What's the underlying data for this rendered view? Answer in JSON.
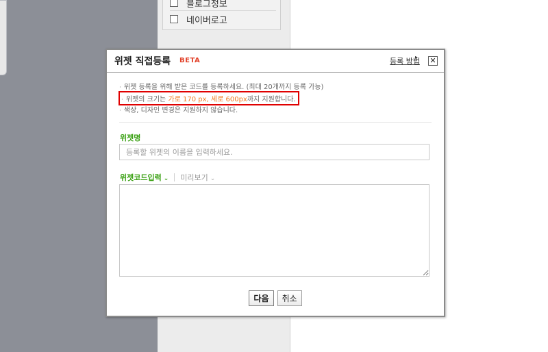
{
  "background": {
    "list_items": [
      {
        "label": "블로그정보"
      },
      {
        "label": "네이버로고"
      }
    ]
  },
  "dialog": {
    "title": "위젯 직접등록",
    "beta": "BETA",
    "help_link": "등록 방법",
    "close": "✕",
    "notices": {
      "n1": "위젯 등록을 위해 받은 코드를 등록하세요. (최대 20개까지 등록 가능)",
      "n2_pre": "위젯의 크기는 ",
      "n2_hl": "가로 170 px, 세로 600px",
      "n2_post": "까지 지원합니다.",
      "n3": "색상, 디자인 변경은 지원하지 않습니다."
    },
    "name_label": "위젯명",
    "name_placeholder": "등록할 위젯의 이름을 입력하세요.",
    "name_value": "",
    "tab_code": "위젯코드입력",
    "tab_preview": "미리보기",
    "code_value": "",
    "next_button": "다음",
    "cancel_button": "취소"
  },
  "colors": {
    "accent_green": "#3ba114",
    "beta_red": "#e2432b",
    "highlight_orange": "#f07a1e",
    "annotation_red": "#e00000"
  }
}
